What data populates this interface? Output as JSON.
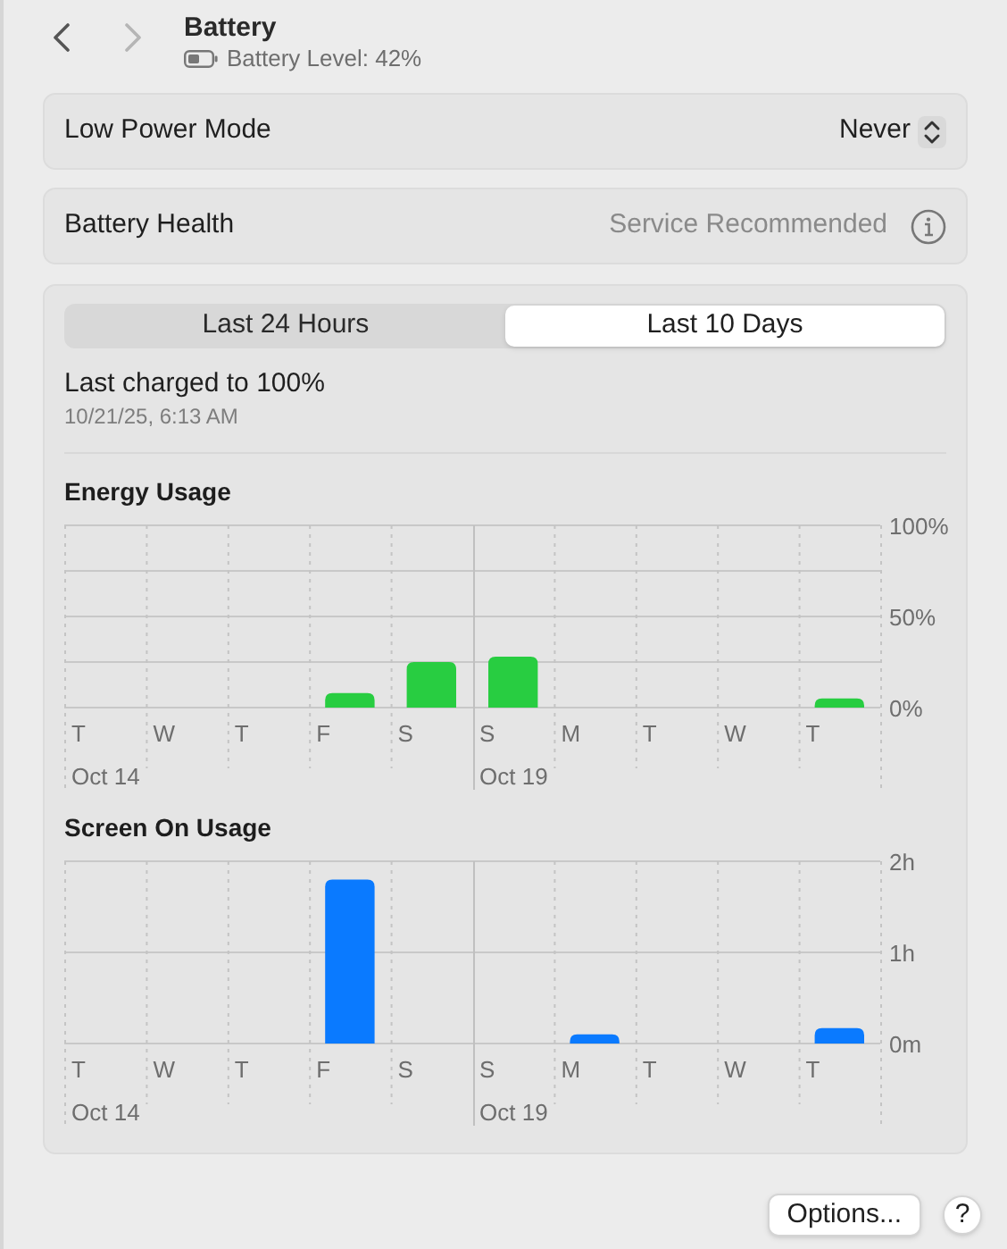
{
  "nav": [
    {
      "kind": "back",
      "disabled": false
    },
    {
      "kind": "forward",
      "disabled": true
    }
  ],
  "header": {
    "title": "Battery",
    "subtitle": "Battery Level: 42%"
  },
  "low_power_mode": {
    "label": "Low Power Mode",
    "value": "Never"
  },
  "battery_health": {
    "label": "Battery Health",
    "value": "Service Recommended"
  },
  "tabs": [
    {
      "label": "Last 24 Hours",
      "selected": false
    },
    {
      "label": "Last 10 Days",
      "selected": true
    }
  ],
  "last_charged": {
    "title": "Last charged to 100%",
    "time": "10/21/25, 6:13 AM"
  },
  "charts": [
    {
      "minor_grid": true,
      "date_labels": [
        "Oct 14",
        "Oct 19"
      ],
      "chart_data": {
        "type": "bar",
        "title": "Energy Usage",
        "categories": [
          "T",
          "W",
          "T",
          "F",
          "S",
          "S",
          "M",
          "T",
          "W",
          "T"
        ],
        "series": [
          {
            "color": "#28cd41",
            "values": [
              0,
              0,
              0,
              8,
              25,
              28,
              0,
              0,
              0,
              5
            ]
          }
        ],
        "ylim": [
          0,
          100
        ],
        "yticks": [
          {
            "value": 0,
            "label": "0%"
          },
          {
            "value": 50,
            "label": "50%"
          },
          {
            "value": 100,
            "label": "100%"
          }
        ]
      }
    },
    {
      "minor_grid": false,
      "date_labels": [
        "Oct 14",
        "Oct 19"
      ],
      "chart_data": {
        "type": "bar",
        "title": "Screen On Usage",
        "categories": [
          "T",
          "W",
          "T",
          "F",
          "S",
          "S",
          "M",
          "T",
          "W",
          "T"
        ],
        "series": [
          {
            "color": "#0a7aff",
            "values": [
              0,
              0,
              0,
              1.8,
              0,
              0,
              0.1,
              0,
              0,
              0.17
            ]
          }
        ],
        "ylim": [
          0,
          2
        ],
        "yticks": [
          {
            "value": 0,
            "label": "0m"
          },
          {
            "value": 1,
            "label": "1h"
          },
          {
            "value": 2,
            "label": "2h"
          }
        ]
      }
    }
  ],
  "footer_buttons": [
    "Options...",
    "?"
  ]
}
